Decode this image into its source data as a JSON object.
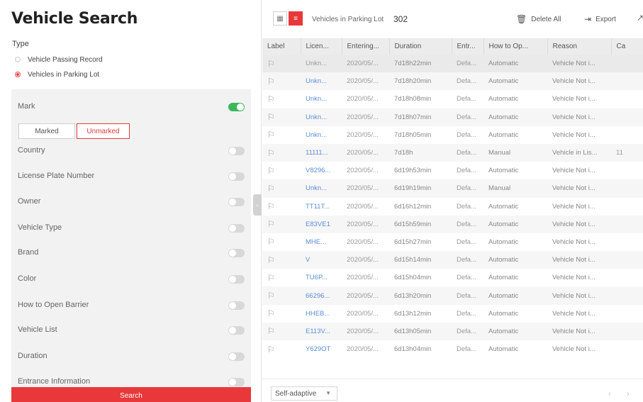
{
  "title": "Vehicle Search",
  "type_section": {
    "label": "Type",
    "options": [
      {
        "label": "Vehicle Passing Record",
        "selected": false
      },
      {
        "label": "Vehicles in Parking Lot",
        "selected": true
      }
    ]
  },
  "filters": {
    "mark": {
      "label": "Mark",
      "enabled": true,
      "marked_label": "Marked",
      "unmarked_label": "Unmarked"
    },
    "items": [
      {
        "label": "Country",
        "enabled": false
      },
      {
        "label": "License Plate Number",
        "enabled": false
      },
      {
        "label": "Owner",
        "enabled": false
      },
      {
        "label": "Vehicle Type",
        "enabled": false
      },
      {
        "label": "Brand",
        "enabled": false
      },
      {
        "label": "Color",
        "enabled": false
      },
      {
        "label": "How to Open Barrier",
        "enabled": false
      },
      {
        "label": "Vehicle List",
        "enabled": false
      },
      {
        "label": "Duration",
        "enabled": false
      },
      {
        "label": "Entrance Information",
        "enabled": false
      }
    ]
  },
  "search_button": "Search",
  "toolbar": {
    "count_label": "Vehicles in Parking Lot",
    "count_value": "302",
    "delete_all": "Delete All",
    "export": "Export"
  },
  "table": {
    "headers": [
      "Label",
      "Licen...",
      "Entering...",
      "Duration",
      "Entr...",
      "How to Op...",
      "Reason",
      "Ca"
    ],
    "rows": [
      {
        "plate": "Unkn...",
        "entering": "2020/05/...",
        "duration": "7d18h22min",
        "entrance": "Defa...",
        "barrier": "Automatic",
        "reason": "Vehicle Not i...",
        "extra": ""
      },
      {
        "plate": "Unkn...",
        "entering": "2020/05/...",
        "duration": "7d18h20min",
        "entrance": "Defa...",
        "barrier": "Automatic",
        "reason": "Vehicle Not i...",
        "extra": ""
      },
      {
        "plate": "Unkn...",
        "entering": "2020/05/...",
        "duration": "7d18h08min",
        "entrance": "Defa...",
        "barrier": "Automatic",
        "reason": "Vehicle Not i...",
        "extra": ""
      },
      {
        "plate": "Unkn...",
        "entering": "2020/05/...",
        "duration": "7d18h07min",
        "entrance": "Defa...",
        "barrier": "Automatic",
        "reason": "Vehicle Not i...",
        "extra": ""
      },
      {
        "plate": "Unkn...",
        "entering": "2020/05/...",
        "duration": "7d18h05min",
        "entrance": "Defa...",
        "barrier": "Automatic",
        "reason": "Vehicle Not i...",
        "extra": ""
      },
      {
        "plate": "11111...",
        "entering": "2020/05/...",
        "duration": "7d18h",
        "entrance": "Defa...",
        "barrier": "Manual",
        "reason": "Vehicle in Lis...",
        "extra": "11"
      },
      {
        "plate": "V8296...",
        "entering": "2020/05/...",
        "duration": "6d19h53min",
        "entrance": "Defa...",
        "barrier": "Automatic",
        "reason": "Vehicle Not i...",
        "extra": ""
      },
      {
        "plate": "Unkn...",
        "entering": "2020/05/...",
        "duration": "6d19h19min",
        "entrance": "Defa...",
        "barrier": "Manual",
        "reason": "Vehicle Not i...",
        "extra": ""
      },
      {
        "plate": "TT11T...",
        "entering": "2020/05/...",
        "duration": "6d16h12min",
        "entrance": "Defa...",
        "barrier": "Automatic",
        "reason": "Vehicle Not i...",
        "extra": ""
      },
      {
        "plate": "E83VE1",
        "entering": "2020/05/...",
        "duration": "6d15h59min",
        "entrance": "Defa...",
        "barrier": "Automatic",
        "reason": "Vehicle Not i...",
        "extra": ""
      },
      {
        "plate": "MHE...",
        "entering": "2020/05/...",
        "duration": "6d15h27min",
        "entrance": "Defa...",
        "barrier": "Automatic",
        "reason": "Vehicle Not i...",
        "extra": ""
      },
      {
        "plate": "V",
        "entering": "2020/05/...",
        "duration": "6d15h14min",
        "entrance": "Defa...",
        "barrier": "Automatic",
        "reason": "Vehicle Not i...",
        "extra": ""
      },
      {
        "plate": "TU6P...",
        "entering": "2020/05/...",
        "duration": "6d15h04min",
        "entrance": "Defa...",
        "barrier": "Automatic",
        "reason": "Vehicle Not i...",
        "extra": ""
      },
      {
        "plate": "66296...",
        "entering": "2020/05/...",
        "duration": "6d13h20min",
        "entrance": "Defa...",
        "barrier": "Automatic",
        "reason": "Vehicle Not i...",
        "extra": ""
      },
      {
        "plate": "HHEB...",
        "entering": "2020/05/...",
        "duration": "6d13h12min",
        "entrance": "Defa...",
        "barrier": "Automatic",
        "reason": "Vehicle Not i...",
        "extra": ""
      },
      {
        "plate": "E113V...",
        "entering": "2020/05/...",
        "duration": "6d13h05min",
        "entrance": "Defa...",
        "barrier": "Automatic",
        "reason": "Vehicle Not i...",
        "extra": ""
      },
      {
        "plate": "Y629OT",
        "entering": "2020/05/...",
        "duration": "6d13h04min",
        "entrance": "Defa...",
        "barrier": "Automatic",
        "reason": "Vehicle Not i...",
        "extra": ""
      }
    ]
  },
  "footer": {
    "page_size": "Self-adaptive"
  },
  "colors": {
    "accent": "#e8383a",
    "toggle_on": "#3cb85a",
    "link": "#5a8fd8"
  },
  "icons": {
    "grid_view": "grid-icon",
    "list_view": "list-icon",
    "delete": "trash-icon",
    "export": "export-icon",
    "open": "open-external-icon",
    "flag": "flag-icon"
  }
}
